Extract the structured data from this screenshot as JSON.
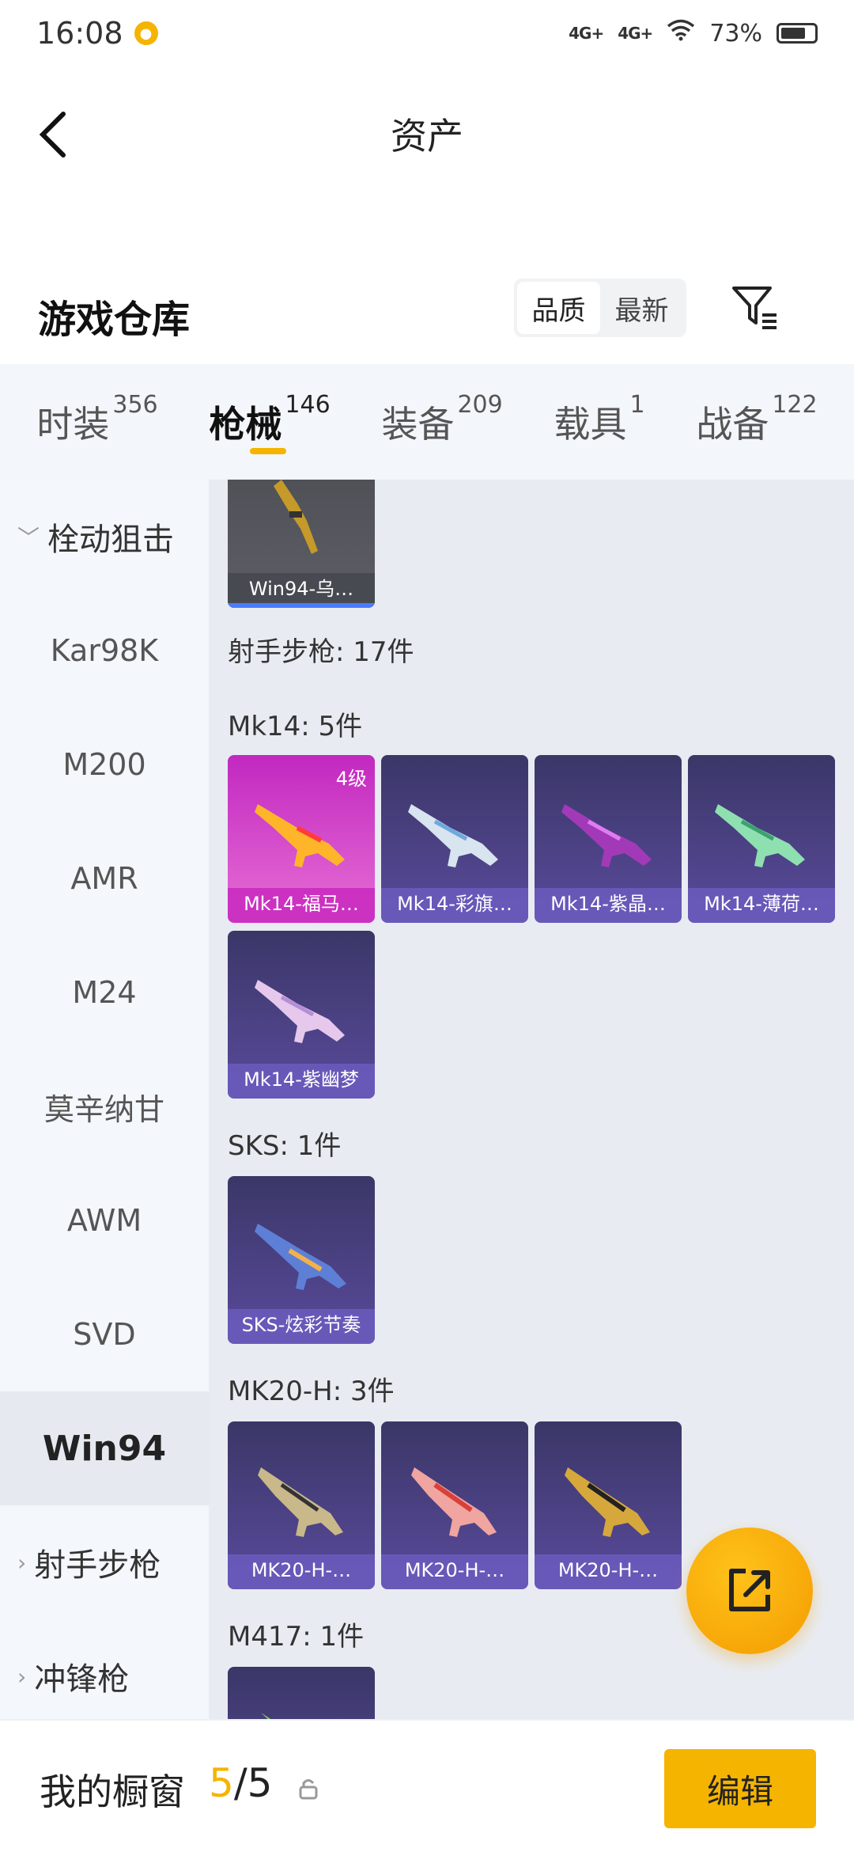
{
  "status_bar": {
    "time": "16:08",
    "signal1": "4G+",
    "signal2": "4G+",
    "battery": "73%"
  },
  "header": {
    "title": "资产"
  },
  "warehouse": {
    "title": "游戏仓库",
    "sort_options": [
      "品质",
      "最新"
    ],
    "active_sort": "品质"
  },
  "tabs": [
    {
      "label": "时装",
      "count": "356"
    },
    {
      "label": "枪械",
      "count": "146"
    },
    {
      "label": "装备",
      "count": "209"
    },
    {
      "label": "载具",
      "count": "1"
    },
    {
      "label": "战备",
      "count": "122"
    }
  ],
  "sidebar": {
    "group_open": "栓动狙击",
    "items": [
      "Kar98K",
      "M200",
      "AMR",
      "M24",
      "莫辛纳甘",
      "AWM",
      "SVD",
      "Win94"
    ],
    "active": "Win94",
    "group_closed_1": "射手步枪",
    "group_closed_2": "冲锋枪"
  },
  "content": {
    "win94_card": "Win94-乌…",
    "marksman_summary": "射手步枪: 17件",
    "mk14_title": "Mk14: 5件",
    "mk14_cards": [
      "Mk14-福马…",
      "Mk14-彩旗…",
      "Mk14-紫晶…",
      "Mk14-薄荷…",
      "Mk14-紫幽梦"
    ],
    "mk14_level": "4级",
    "sks_title": "SKS: 1件",
    "sks_cards": [
      "SKS-炫彩节奏"
    ],
    "mk20_title": "MK20-H: 3件",
    "mk20_cards": [
      "MK20-H-…",
      "MK20-H-…",
      "MK20-H-…"
    ],
    "m417_title": "M417: 1件"
  },
  "bottom": {
    "showcase_label": "我的橱窗",
    "showcase_current": "5",
    "showcase_total": "/5",
    "edit_label": "编辑"
  },
  "colors": {
    "accent": "#f5b400",
    "card_purple": "#4a3f86",
    "card_gold": "#c228c0"
  }
}
